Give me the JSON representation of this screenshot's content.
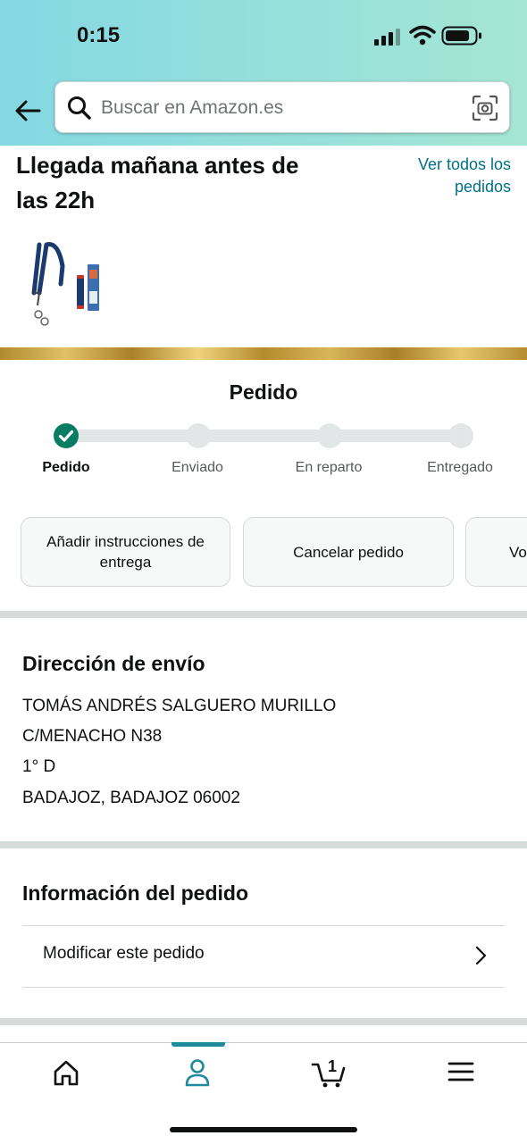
{
  "status_bar": {
    "time": "0:15"
  },
  "search": {
    "placeholder": "Buscar en Amazon.es"
  },
  "order": {
    "arrival_text": "Llegada mañana antes de las 22h",
    "view_all_orders": "Ver todos los pedidos"
  },
  "tracking": {
    "title": "Pedido",
    "progress": 0,
    "steps": [
      {
        "label": "Pedido",
        "completed": true
      },
      {
        "label": "Enviado",
        "completed": false
      },
      {
        "label": "En reparto",
        "completed": false
      },
      {
        "label": "Entregado",
        "completed": false
      }
    ]
  },
  "actions": [
    {
      "label": "Añadir instrucciones de entrega"
    },
    {
      "label": "Cancelar pedido"
    },
    {
      "label": "Vo"
    }
  ],
  "shipping": {
    "title": "Dirección de envío",
    "lines": [
      "TOMÁS ANDRÉS SALGUERO MURILLO",
      "C/MENACHO N38",
      "1° D",
      "BADAJOZ, BADAJOZ 06002"
    ]
  },
  "order_info": {
    "title": "Información del pedido",
    "modify_label": "Modificar este pedido"
  },
  "tabbar": {
    "items": [
      "home-icon",
      "account-icon",
      "cart-icon",
      "menu-icon"
    ],
    "active": "account-icon",
    "cart_count": "1"
  },
  "colors": {
    "accent": "#067d62",
    "link": "#007185",
    "tab_active": "#1e8a9c"
  }
}
